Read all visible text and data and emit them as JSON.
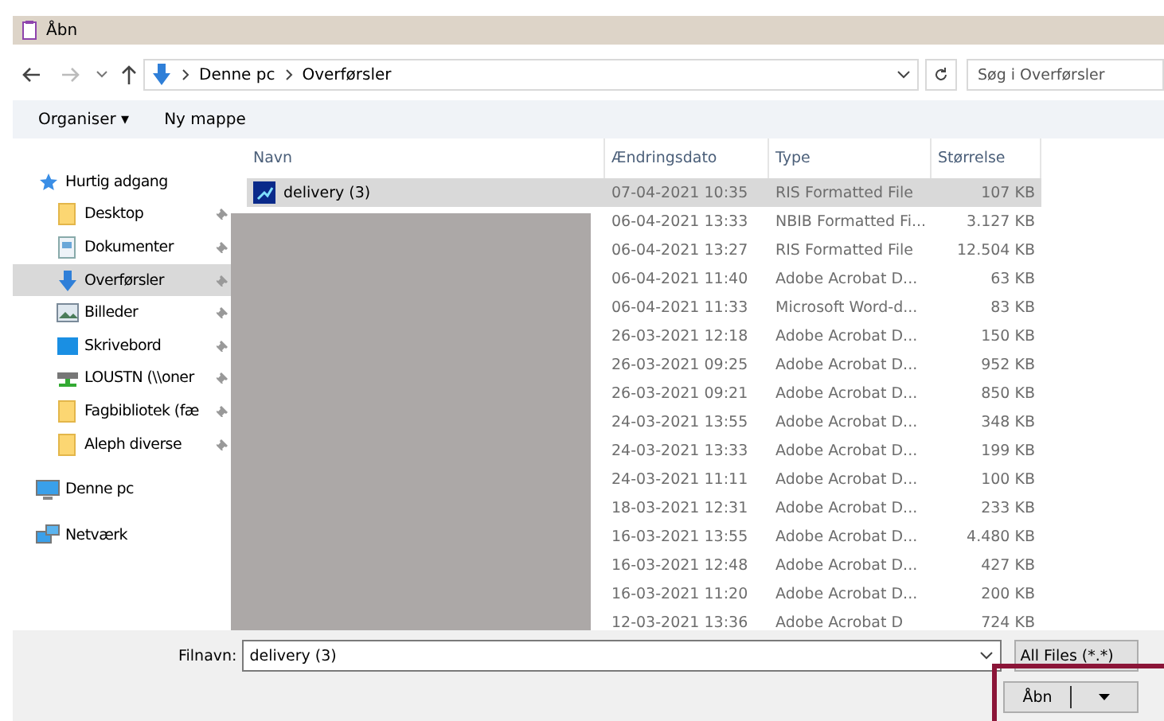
{
  "window": {
    "title": "Åbn"
  },
  "address_bar": {
    "path": [
      "Denne pc",
      "Overførsler"
    ],
    "search_placeholder": "Søg i Overførsler"
  },
  "toolbar": {
    "organize": "Organiser ▾",
    "new_folder": "Ny mappe"
  },
  "sidebar": {
    "items": [
      {
        "label": "Hurtig adgang",
        "kind": "star",
        "pinned": false,
        "selected": false,
        "group": true
      },
      {
        "label": "Desktop",
        "kind": "folder",
        "pinned": true,
        "selected": false,
        "group": false
      },
      {
        "label": "Dokumenter",
        "kind": "document",
        "pinned": true,
        "selected": false,
        "group": false
      },
      {
        "label": "Overførsler",
        "kind": "download",
        "pinned": true,
        "selected": true,
        "group": false
      },
      {
        "label": "Billeder",
        "kind": "pictures",
        "pinned": true,
        "selected": false,
        "group": false
      },
      {
        "label": "Skrivebord",
        "kind": "desktop",
        "pinned": true,
        "selected": false,
        "group": false
      },
      {
        "label": "LOUSTN (\\\\oner",
        "kind": "drive",
        "pinned": true,
        "selected": false,
        "group": false
      },
      {
        "label": "Fagbibliotek (fæ",
        "kind": "folder",
        "pinned": true,
        "selected": false,
        "group": false
      },
      {
        "label": "Aleph diverse",
        "kind": "folder",
        "pinned": true,
        "selected": false,
        "group": false
      },
      {
        "label": "Denne pc",
        "kind": "computer",
        "pinned": false,
        "selected": false,
        "group": true
      },
      {
        "label": "Netværk",
        "kind": "network",
        "pinned": false,
        "selected": false,
        "group": true
      }
    ]
  },
  "table": {
    "columns": [
      "Navn",
      "Ændringsdato",
      "Type",
      "Størrelse"
    ],
    "rows": [
      {
        "name": "delivery (3)",
        "date": "07-04-2021 10:35",
        "type": "RIS Formatted File",
        "size": "107 KB",
        "selected": true
      },
      {
        "date": "06-04-2021 13:33",
        "type": "NBIB Formatted Fi...",
        "size": "3.127 KB",
        "selected": false
      },
      {
        "date": "06-04-2021 13:27",
        "type": "RIS Formatted File",
        "size": "12.504 KB",
        "selected": false
      },
      {
        "date": "06-04-2021 11:40",
        "type": "Adobe Acrobat D...",
        "size": "63 KB",
        "selected": false
      },
      {
        "date": "06-04-2021 11:33",
        "type": "Microsoft Word-d...",
        "size": "83 KB",
        "selected": false
      },
      {
        "date": "26-03-2021 12:18",
        "type": "Adobe Acrobat D...",
        "size": "150 KB",
        "selected": false
      },
      {
        "date": "26-03-2021 09:25",
        "type": "Adobe Acrobat D...",
        "size": "952 KB",
        "selected": false
      },
      {
        "date": "26-03-2021 09:21",
        "type": "Adobe Acrobat D...",
        "size": "850 KB",
        "selected": false
      },
      {
        "date": "24-03-2021 13:55",
        "type": "Adobe Acrobat D...",
        "size": "348 KB",
        "selected": false
      },
      {
        "date": "24-03-2021 13:33",
        "type": "Adobe Acrobat D...",
        "size": "199 KB",
        "selected": false
      },
      {
        "date": "24-03-2021 11:11",
        "type": "Adobe Acrobat D...",
        "size": "100 KB",
        "selected": false
      },
      {
        "date": "18-03-2021 12:31",
        "type": "Adobe Acrobat D...",
        "size": "233 KB",
        "selected": false
      },
      {
        "date": "16-03-2021 13:55",
        "type": "Adobe Acrobat D...",
        "size": "4.480 KB",
        "selected": false
      },
      {
        "date": "16-03-2021 12:48",
        "type": "Adobe Acrobat D...",
        "size": "427 KB",
        "selected": false
      },
      {
        "date": "16-03-2021 11:20",
        "type": "Adobe Acrobat D...",
        "size": "200 KB",
        "selected": false
      },
      {
        "date": "12-03-2021 13:36",
        "type": "Adobe Acrobat D",
        "size": "724 KB",
        "selected": false
      }
    ]
  },
  "footer": {
    "filename_label": "Filnavn:",
    "filename": "delivery (3)",
    "filter": "All Files (*.*)",
    "open_button": "Åbn"
  }
}
